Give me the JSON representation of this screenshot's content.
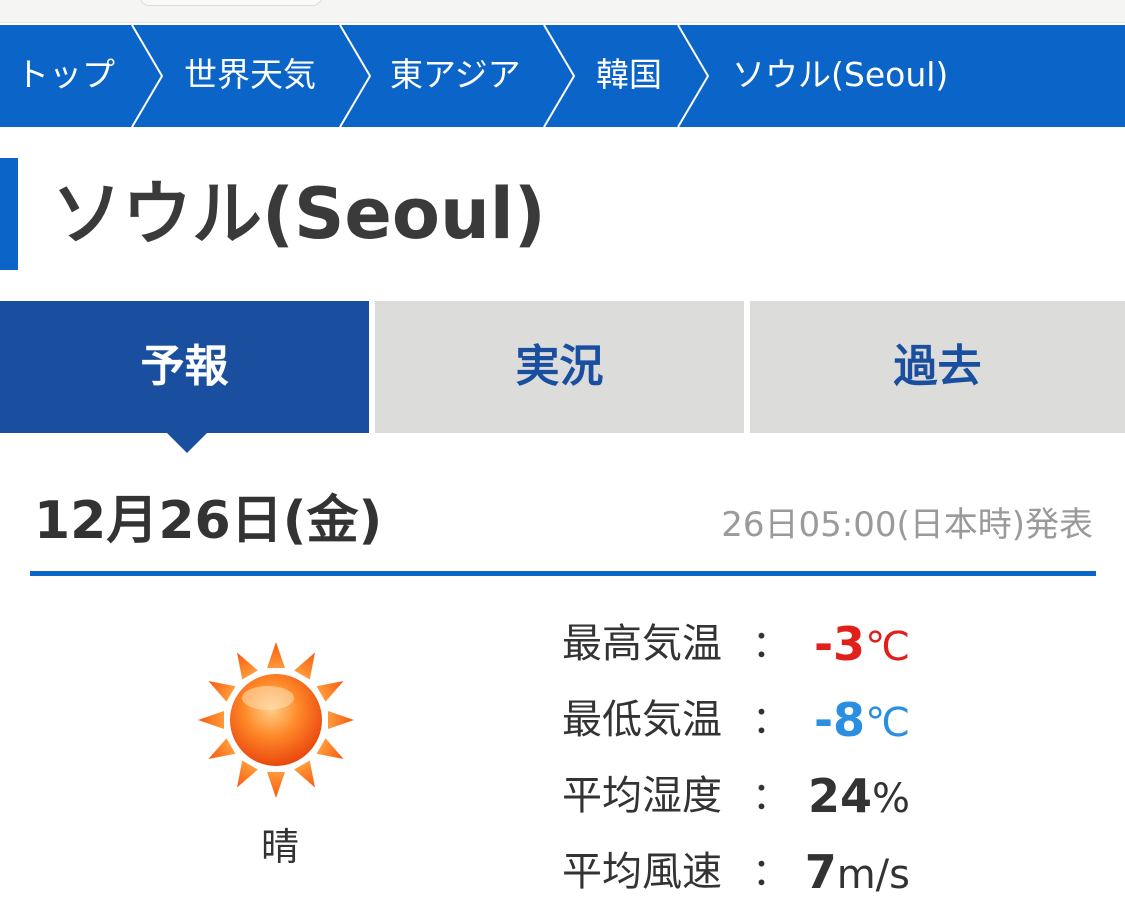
{
  "breadcrumb": {
    "items": [
      {
        "label": "トップ"
      },
      {
        "label": "世界天気"
      },
      {
        "label": "東アジア"
      },
      {
        "label": "韓国"
      },
      {
        "label": "ソウル(Seoul)"
      }
    ]
  },
  "page": {
    "title": "ソウル(Seoul)"
  },
  "tabs": [
    {
      "label": "予報",
      "active": true
    },
    {
      "label": "実況",
      "active": false
    },
    {
      "label": "過去",
      "active": false
    }
  ],
  "forecast": {
    "date": "12月26日(金)",
    "issued": "26日05:00(日本時)発表",
    "weather_icon": "sun-icon",
    "weather_label": "晴",
    "stats": {
      "high_temp": {
        "label": "最高気温",
        "colon": "：",
        "value": "-3",
        "unit": "℃",
        "color": "#e0201b"
      },
      "low_temp": {
        "label": "最低気温",
        "colon": "：",
        "value": "-8",
        "unit": "℃",
        "color": "#2a8fe0"
      },
      "humidity": {
        "label": "平均湿度",
        "colon": "：",
        "value": "24",
        "unit": "%",
        "color": "#333333"
      },
      "wind": {
        "label": "平均風速",
        "colon": "：",
        "value": "7",
        "unit": "m/s",
        "color": "#333333"
      }
    }
  },
  "colors": {
    "brand_blue": "#0b64c8",
    "tab_active": "#1a4fa0",
    "tab_inactive": "#dcdcda"
  }
}
